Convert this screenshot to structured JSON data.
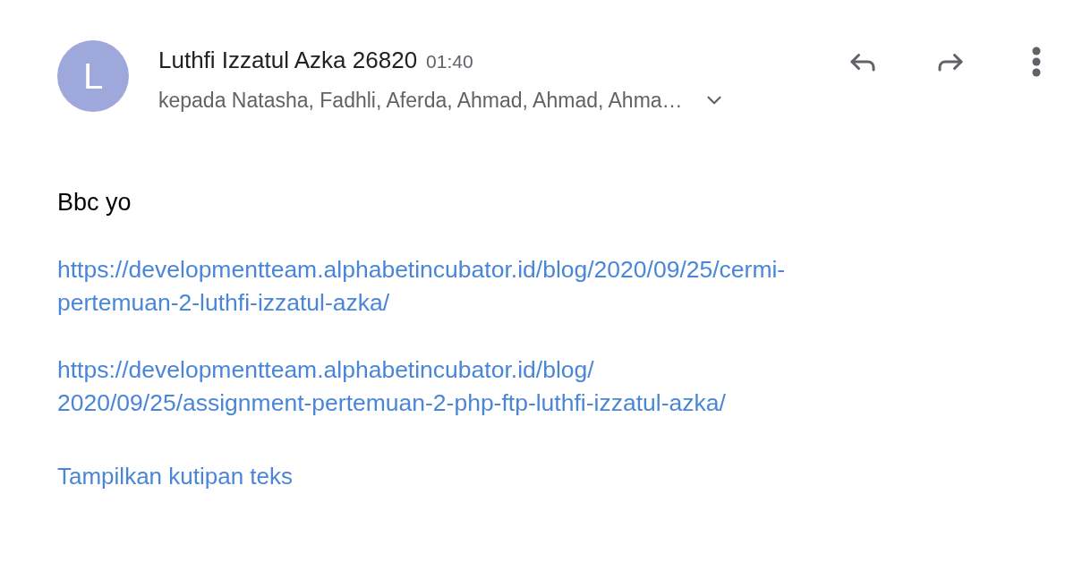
{
  "sender": {
    "initial": "L",
    "name": "Luthfi Izzatul Azka 26820",
    "time": "01:40",
    "recipients": "kepada Natasha, Fadhli, Aferda, Ahmad, Ahmad, Ahma…"
  },
  "body": {
    "greeting": "Bbc yo",
    "links": [
      {
        "lines": [
          "https://developmentteam.alphabetincubator.id/blog/2020/09/25/cermi-",
          "pertemuan-2-luthfi-izzatul-azka/"
        ]
      },
      {
        "lines": [
          "https://developmentteam.alphabetincubator.id/blog/",
          "2020/09/25/assignment-pertemuan-2-php-ftp-luthfi-izzatul-azka/"
        ]
      }
    ],
    "show_quoted": "Tampilkan kutipan teks"
  }
}
